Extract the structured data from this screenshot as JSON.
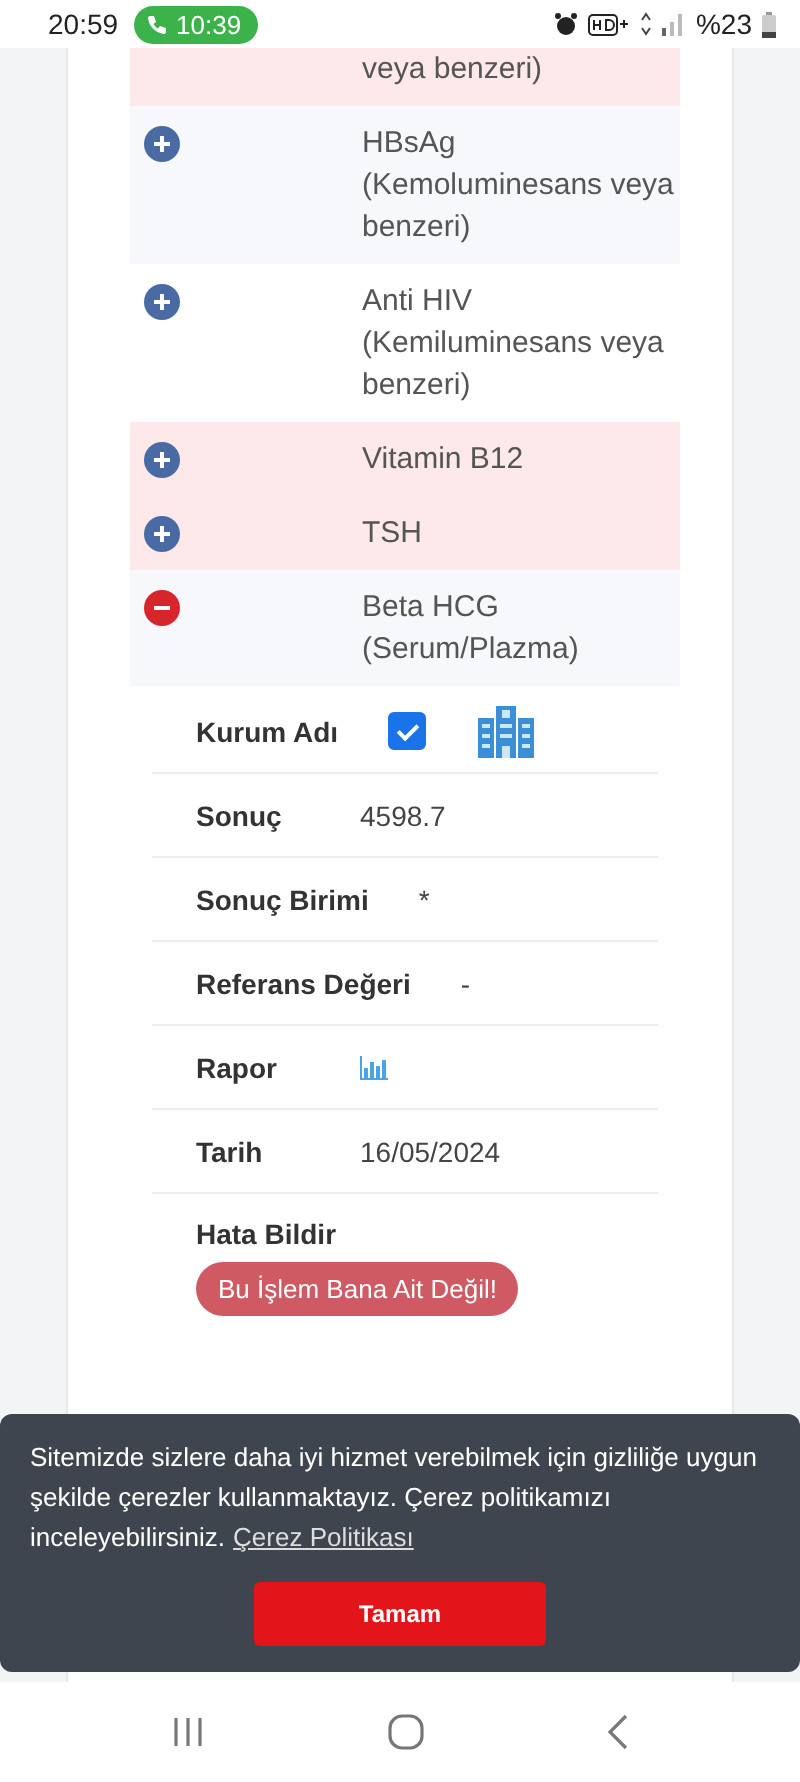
{
  "status_bar": {
    "time": "20:59",
    "call_time": "10:39",
    "battery": "%23"
  },
  "tests": [
    {
      "name": "veya benzeri)",
      "highlighted": true,
      "partial": true
    },
    {
      "name": "HBsAg (Kemoluminesans veya benzeri)",
      "expanded": false,
      "highlighted": false
    },
    {
      "name": "Anti HIV (Kemiluminesans veya benzeri)",
      "expanded": false,
      "highlighted": false
    },
    {
      "name": "Vitamin B12",
      "expanded": false,
      "highlighted": true
    },
    {
      "name": "TSH",
      "expanded": false,
      "highlighted": true
    },
    {
      "name": "Beta HCG (Serum/Plazma)",
      "expanded": true,
      "highlighted": false,
      "details": [
        {
          "kind": "institution",
          "label": "Kurum Adı",
          "checked": true
        },
        {
          "kind": "text",
          "label": "Sonuç",
          "value": "4598.7"
        },
        {
          "kind": "text",
          "label": "Sonuç Birimi",
          "value": "*"
        },
        {
          "kind": "text",
          "label": "Referans Değeri",
          "value": "-"
        },
        {
          "kind": "report",
          "label": "Rapor"
        },
        {
          "kind": "text",
          "label": "Tarih",
          "value": "16/05/2024"
        },
        {
          "kind": "action",
          "label": "Hata Bildir",
          "button": "Bu İşlem Bana Ait Değil!"
        }
      ]
    }
  ],
  "cookie_banner": {
    "text": "Sitemizde sizlere daha iyi hizmet verebilmek için gizliliğe uygun şekilde çerezler kullanmaktayız. Çerez politikamızı inceleyebilirsiniz.",
    "link": "Çerez Politikası",
    "button": "Tamam"
  }
}
